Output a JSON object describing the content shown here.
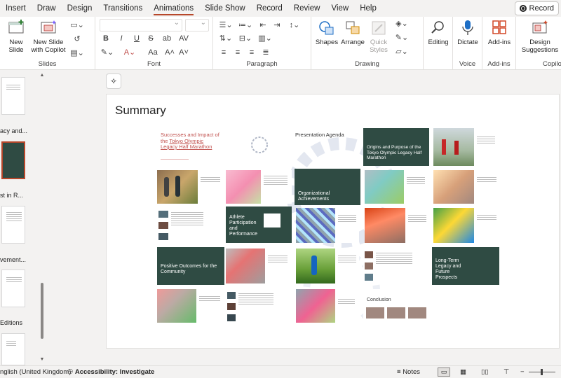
{
  "menu": {
    "tabs": [
      "Insert",
      "Draw",
      "Design",
      "Transitions",
      "Animations",
      "Slide Show",
      "Record",
      "Review",
      "View",
      "Help"
    ],
    "active_index": 4,
    "record_label": "Record"
  },
  "ribbon": {
    "slides": {
      "label": "Slides",
      "new_slide": "New Slide",
      "new_slide_copilot": "New Slide with Copilot"
    },
    "font": {
      "label": "Font"
    },
    "paragraph": {
      "label": "Paragraph"
    },
    "drawing": {
      "label": "Drawing",
      "shapes": "Shapes",
      "arrange": "Arrange",
      "quick_styles": "Quick Styles"
    },
    "editing": {
      "label": "Editing"
    },
    "voice": {
      "label": "Voice",
      "dictate": "Dictate"
    },
    "addins": {
      "label": "Add-ins",
      "addins_btn": "Add-ins"
    },
    "copilot": {
      "label": "Copilot",
      "design_suggestions": "Design Suggestions"
    }
  },
  "thumbnails": {
    "partial_labels": [
      "acy and...",
      "st in R...",
      "vement...",
      "Editions"
    ]
  },
  "slide": {
    "title": "Summary",
    "summary": {
      "cover_title_a": "Successes and Impact of the ",
      "cover_title_b": "Tokyo Olympic Legacy Half Marathon",
      "agenda": "Presentation Agenda",
      "origins": "Origins and Purpose of the Tokyo Olympic Legacy Half Marathon",
      "organizational": "Organizational Achievements",
      "athlete": "Athlete Participation and Performance",
      "positive": "Positive Outcomes for the Community",
      "long_term": "Long-Term Legacy and Future Prospects",
      "conclusion": "Conclusion"
    }
  },
  "status": {
    "language": "nglish (United Kingdom)",
    "accessibility": "Accessibility: Investigate",
    "notes": "Notes"
  },
  "colors": {
    "accent": "#b7472a",
    "slide_green": "#2f4b43",
    "cover_red": "#c0504d"
  }
}
